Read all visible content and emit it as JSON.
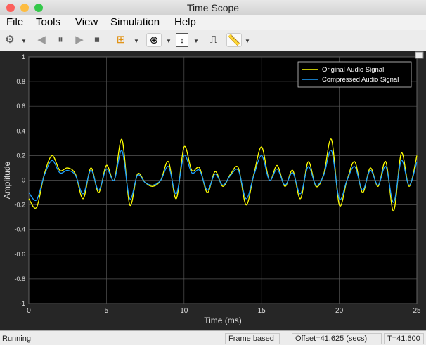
{
  "window": {
    "title": "Time Scope"
  },
  "menu": [
    "File",
    "Tools",
    "View",
    "Simulation",
    "Help"
  ],
  "toolbar": [
    {
      "icon": "gear-icon"
    },
    {
      "icon": "step-back-icon"
    },
    {
      "icon": "pause-icon"
    },
    {
      "icon": "step-forward-icon"
    },
    {
      "icon": "stop-icon"
    },
    {
      "icon": "highlight-block-icon"
    },
    {
      "icon": "zoom-in-icon"
    },
    {
      "icon": "scale-axes-icon"
    },
    {
      "icon": "signal-trigger-icon"
    },
    {
      "icon": "measurement-ruler-icon"
    }
  ],
  "status": {
    "state": "Running",
    "mode": "Frame based",
    "offset": "Offset=41.625 (secs)",
    "time": "T=41.600"
  },
  "colors": {
    "original": "#ffff00",
    "compressed": "#1ea0ff",
    "axes_bg": "#000000",
    "figure_bg": "#262626"
  },
  "chart_data": {
    "type": "line",
    "xlabel": "Time (ms)",
    "ylabel": "Amplitude",
    "xlim": [
      0,
      25
    ],
    "ylim": [
      -1,
      1
    ],
    "xticks": [
      "0",
      "5",
      "10",
      "15",
      "20",
      "25"
    ],
    "yticks": [
      "-1",
      "-0.8",
      "-0.6",
      "-0.4",
      "-0.2",
      "0",
      "0.2",
      "0.4",
      "0.6",
      "0.8",
      "1"
    ],
    "grid": true,
    "legend_placement": "top-right",
    "x": [
      0,
      0.5,
      1,
      1.5,
      2,
      2.5,
      3,
      3.5,
      4,
      4.5,
      5,
      5.5,
      6,
      6.5,
      7,
      7.5,
      8,
      8.5,
      9,
      9.5,
      10,
      10.5,
      11,
      11.5,
      12,
      12.5,
      13,
      13.5,
      14,
      14.5,
      15,
      15.5,
      16,
      16.5,
      17,
      17.5,
      18,
      18.5,
      19,
      19.5,
      20,
      20.5,
      21,
      21.5,
      22,
      22.5,
      23,
      23.5,
      24,
      24.5,
      25
    ],
    "series": [
      {
        "name": "Original Audio Signal",
        "values": [
          -0.15,
          -0.22,
          0.05,
          0.2,
          0.08,
          0.1,
          0.05,
          -0.15,
          0.1,
          -0.1,
          0.12,
          0.0,
          0.33,
          -0.2,
          0.05,
          -0.02,
          -0.05,
          0.0,
          0.15,
          -0.15,
          0.27,
          0.08,
          0.1,
          -0.1,
          0.07,
          -0.05,
          0.05,
          0.1,
          -0.2,
          0.05,
          0.27,
          0.0,
          0.12,
          -0.05,
          0.08,
          -0.15,
          0.15,
          -0.05,
          0.05,
          0.33,
          -0.2,
          0.0,
          0.15,
          -0.1,
          0.1,
          -0.05,
          0.15,
          -0.25,
          0.22,
          -0.05,
          0.2
        ]
      },
      {
        "name": "Compressed Audio Signal",
        "values": [
          -0.1,
          -0.16,
          0.04,
          0.16,
          0.06,
          0.08,
          0.04,
          -0.11,
          0.08,
          -0.08,
          0.09,
          0.0,
          0.24,
          -0.15,
          0.04,
          -0.02,
          -0.04,
          0.0,
          0.11,
          -0.11,
          0.2,
          0.06,
          0.08,
          -0.08,
          0.05,
          -0.04,
          0.04,
          0.08,
          -0.15,
          0.04,
          0.2,
          0.0,
          0.09,
          -0.04,
          0.06,
          -0.11,
          0.11,
          -0.04,
          0.04,
          0.24,
          -0.15,
          0.0,
          0.11,
          -0.08,
          0.08,
          -0.04,
          0.11,
          -0.18,
          0.16,
          -0.04,
          0.15
        ]
      }
    ]
  }
}
